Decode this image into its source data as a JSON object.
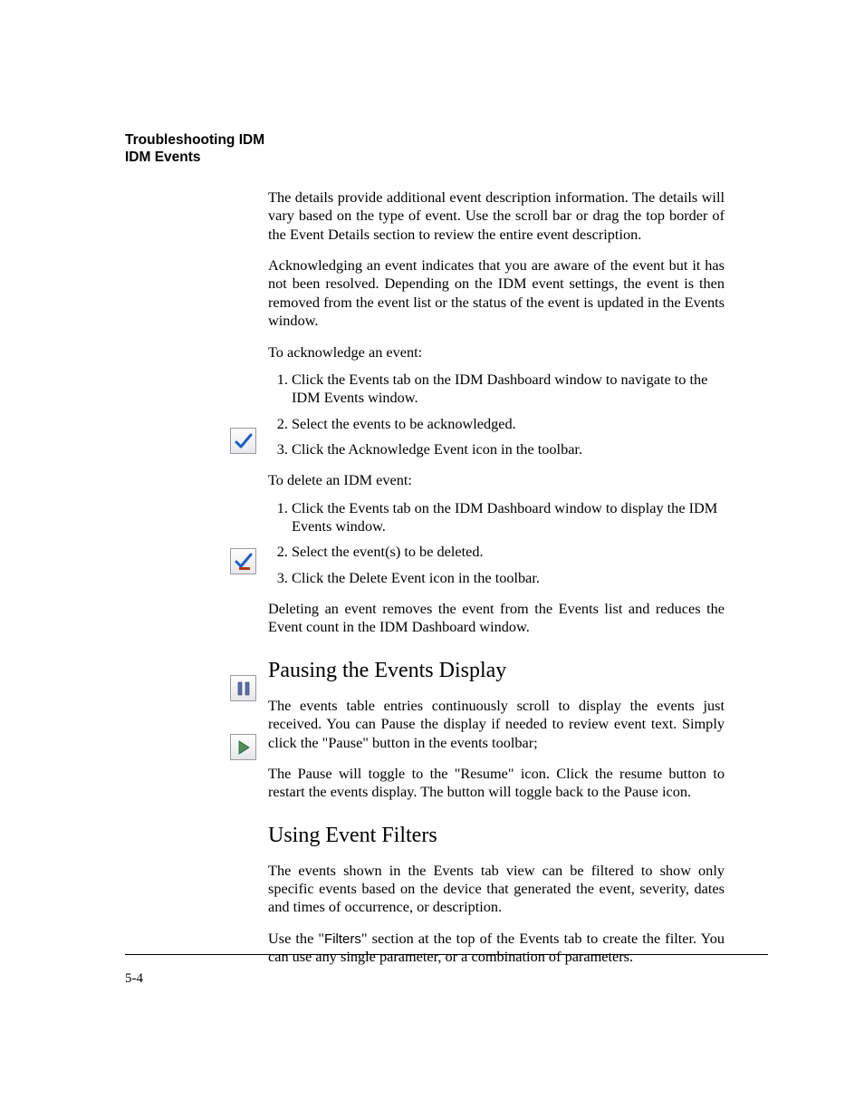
{
  "header": {
    "line1": "Troubleshooting IDM",
    "line2": "IDM Events"
  },
  "para_details": "The details provide additional event description information. The details will vary based on the type of event. Use the scroll bar or drag the top border of the Event Details section to review the entire event description.",
  "para_ack": "Acknowledging an event indicates that you are aware of the event but it has not been resolved. Depending on the IDM event settings, the event is then removed from the event list or the status of the event is updated in the Events window.",
  "ack_lead": "To acknowledge an event:",
  "ack_steps": [
    "Click the Events tab on the IDM Dashboard window to navigate to the IDM Events window.",
    "Select the events to be acknowledged.",
    "Click the Acknowledge Event icon in the toolbar."
  ],
  "del_lead": "To delete an IDM event:",
  "del_steps": [
    "Click the Events tab on the IDM Dashboard window to display the IDM Events window.",
    "Select the event(s) to be deleted.",
    "Click the Delete Event icon in the toolbar."
  ],
  "para_delete_result": "Deleting an event removes the event from the Events list and reduces the Event count in the IDM Dashboard window.",
  "heading_pause": "Pausing the Events Display",
  "para_pause1": "The events table entries continuously scroll to display the events just received. You can Pause the display if needed to review event text. Simply click the \"Pause\" button in the events toolbar;",
  "para_pause2": "The Pause will toggle to the \"Resume\" icon. Click the resume button to restart the events display. The button will toggle back to the Pause icon.",
  "heading_filters": "Using Event Filters",
  "para_filters1": "The events shown in the Events tab view can be filtered to show only specific events based on the device that generated the event, severity, dates and times of occurrence, or description.",
  "filters_pre": "Use the \"",
  "filters_word": "Filters",
  "filters_post": "\" section at the top of the Events tab to create the filter. You can use any single parameter, or a combination of parameters.",
  "page_number": "5-4"
}
